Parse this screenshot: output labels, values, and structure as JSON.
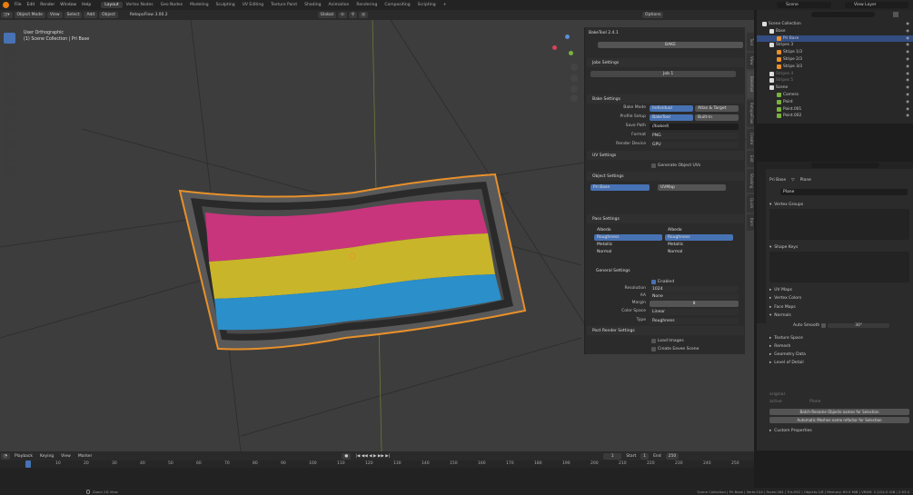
{
  "topbar": {
    "menus": [
      "File",
      "Edit",
      "Render",
      "Window",
      "Help"
    ],
    "workspaces": [
      "Layout",
      "Vertex Nodes",
      "Geo Nodes",
      "Modeling",
      "Sculpting",
      "UV Editing",
      "Texture Paint",
      "Shading",
      "Animation",
      "Rendering",
      "Compositing",
      "Scripting"
    ],
    "scene": "Scene",
    "view_layer": "View Layer"
  },
  "header": {
    "mode": "Object Mode",
    "menus": [
      "View",
      "Select",
      "Add",
      "Object"
    ],
    "addon": "RetopoFlow 3.00.2",
    "orientation": "Global",
    "options": "Options"
  },
  "viewport": {
    "view_name": "User Orthographic",
    "collection": "(1) Scene Collection | Pri Base",
    "colors": {
      "pink": "#c8357d",
      "yellow": "#c9b52a",
      "blue": "#2b8fc9",
      "outline": "#e8902a"
    }
  },
  "baketool": {
    "title": "BakeTool 2.4.1",
    "bake_btn": "BAKE",
    "jobs_settings": "Jobs Settings",
    "job_name": "Job 1",
    "bake_settings": "Bake Settings",
    "bake_mode_label": "Bake Mode",
    "bake_mode_opts": [
      "Individual",
      "Atlas & Target"
    ],
    "profile_label": "Profile Setup",
    "profile_opts": [
      "BakeTool",
      "Built-in"
    ],
    "save_path_label": "Save Path",
    "save_path": "//baked\\",
    "format_label": "Format",
    "format": "PNG",
    "device_label": "Render Device",
    "device": "GPU",
    "uv_settings": "UV Settings",
    "gen_uvs": "Generate Object UVs",
    "object_settings": "Object Settings",
    "obj_name": "Pri Base",
    "uv_map": "UVMap",
    "pass_settings": "Pass Settings",
    "passes": [
      {
        "name": "Albedo",
        "type": "Albedo"
      },
      {
        "name": "Roughness",
        "type": "Roughness"
      },
      {
        "name": "Metallic",
        "type": "Metallic"
      },
      {
        "name": "Normal",
        "type": "Normal"
      }
    ],
    "general_settings": "General Settings",
    "enabled": "Enabled",
    "resolution_label": "Resolution",
    "resolution": "1024",
    "aa_label": "AA",
    "aa": "None",
    "margin_label": "Margin",
    "margin": "8",
    "colorspace_label": "Color Space",
    "colorspace": "Linear",
    "type_label": "Type",
    "type": "Roughness",
    "post_render": "Post Render Settings",
    "load_images": "Load Images",
    "create_eevee": "Create Eevee Scene"
  },
  "side_tabs": [
    "Tool",
    "View",
    "Baketool",
    "RetopoFlow",
    "Create",
    "Edit",
    "Shading",
    "Quick",
    "Item"
  ],
  "outliner": {
    "search_placeholder": "",
    "items": [
      {
        "name": "Scene Collection",
        "indent": 0,
        "kind": "coll"
      },
      {
        "name": "Base",
        "indent": 1,
        "kind": "coll"
      },
      {
        "name": "Pri Base",
        "indent": 2,
        "kind": "mesh",
        "selected": true
      },
      {
        "name": "Stripes 3",
        "indent": 1,
        "kind": "coll"
      },
      {
        "name": "Stripe 1/3",
        "indent": 2,
        "kind": "mesh"
      },
      {
        "name": "Stripe 2/3",
        "indent": 2,
        "kind": "mesh"
      },
      {
        "name": "Stripe 3/3",
        "indent": 2,
        "kind": "mesh"
      },
      {
        "name": "Stripes 4",
        "indent": 1,
        "kind": "coll",
        "dim": true
      },
      {
        "name": "Stripes 5",
        "indent": 1,
        "kind": "coll",
        "dim": true
      },
      {
        "name": "Scene",
        "indent": 1,
        "kind": "coll"
      },
      {
        "name": "Camera",
        "indent": 2,
        "kind": "cam"
      },
      {
        "name": "Point",
        "indent": 2,
        "kind": "light"
      },
      {
        "name": "Point.001",
        "indent": 2,
        "kind": "light"
      },
      {
        "name": "Point.002",
        "indent": 2,
        "kind": "light"
      }
    ]
  },
  "properties": {
    "object": "Pri Base",
    "data": "Plane",
    "mesh_name": "Plane",
    "sections": [
      "Vertex Groups",
      "Shape Keys",
      "UV Maps",
      "Vertex Colors",
      "Face Maps",
      "Normals",
      "Texture Space",
      "Remesh",
      "Geometry Data",
      "Level of Detail",
      "Custom Properties"
    ],
    "auto_smooth": "Auto Smooth",
    "auto_smooth_val": "30°",
    "lod_original": "original",
    "lod_active": "active",
    "lod_plane": "Plane",
    "batch_btn": "Batch-Rename Objects-names for Selection",
    "auto_btn": "Automatic Meshes-name refactor for Selection"
  },
  "timeline": {
    "menus": [
      "Playback",
      "Keying",
      "View",
      "Marker"
    ],
    "current": "1",
    "start_label": "Start",
    "start": "1",
    "end_label": "End",
    "end": "250",
    "ticks": [
      "1",
      "10",
      "20",
      "30",
      "40",
      "50",
      "60",
      "70",
      "80",
      "90",
      "100",
      "110",
      "120",
      "130",
      "140",
      "150",
      "160",
      "170",
      "180",
      "190",
      "200",
      "210",
      "220",
      "230",
      "240",
      "250"
    ]
  },
  "status": {
    "left": "Zoom 2D View",
    "right": "Scene Collection | Pri Base | Verts:104 | Faces:264 | Tris:592 | Objects:1/8 | Memory: 69.0 MiB | VRAM: 2.2/24.0 GiB | 2.93.0"
  }
}
